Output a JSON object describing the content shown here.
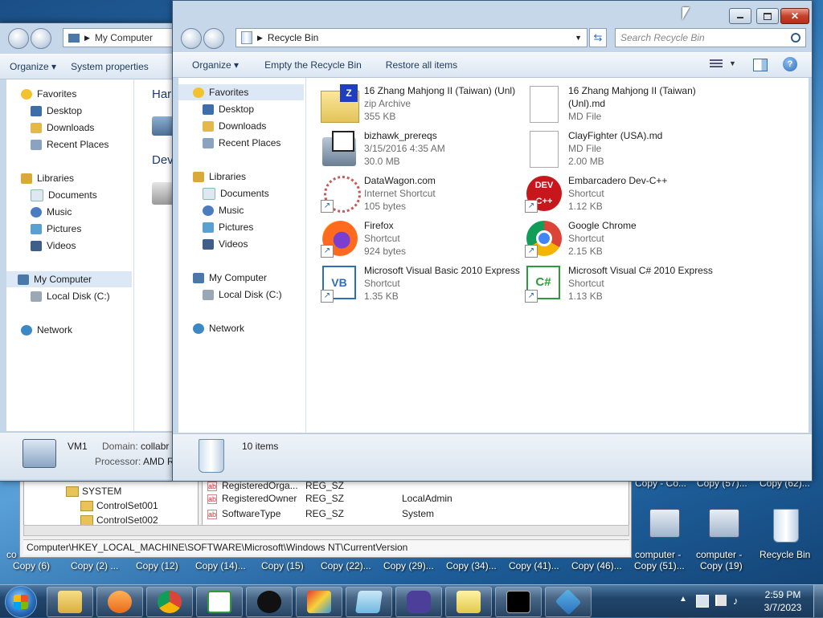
{
  "desktop": {
    "labels": [
      "Copy (6)",
      "Copy (2) ...",
      "Copy (12)",
      "Copy (14)...",
      "Copy (15)",
      "Copy (22)...",
      "Copy (29)...",
      "Copy (34)...",
      "Copy (41)...",
      "Copy (46)...",
      "Copy (51)...",
      "Copy (19)"
    ],
    "top_labels": [
      "Copy - Co...",
      "Copy (57)...",
      "Copy (62)..."
    ],
    "icon_labels": [
      "computer - ",
      "computer - ",
      "Recycle Bin"
    ],
    "left_fragment": "co"
  },
  "back_window": {
    "address": "My Computer",
    "cmd": {
      "organize": "Organize",
      "system_properties": "System properties"
    },
    "nav": {
      "favorites": "Favorites",
      "desktop": "Desktop",
      "downloads": "Downloads",
      "recent": "Recent Places",
      "libraries": "Libraries",
      "documents": "Documents",
      "music": "Music",
      "pictures": "Pictures",
      "videos": "Videos",
      "computer": "My Computer",
      "local_disk": "Local Disk (C:)",
      "network": "Network"
    },
    "content": {
      "group1": "Har",
      "group2": "Dev"
    },
    "status": {
      "name": "VM1",
      "domain_label": "Domain:",
      "domain_value": "collabr",
      "processor_label": "Processor:",
      "processor_value": "AMD R"
    }
  },
  "front_window": {
    "address": "Recycle Bin",
    "search_placeholder": "Search Recycle Bin",
    "cmd": {
      "organize": "Organize",
      "empty": "Empty the Recycle Bin",
      "restore": "Restore all items"
    },
    "nav": {
      "favorites": "Favorites",
      "desktop": "Desktop",
      "downloads": "Downloads",
      "recent": "Recent Places",
      "libraries": "Libraries",
      "documents": "Documents",
      "music": "Music",
      "pictures": "Pictures",
      "videos": "Videos",
      "computer": "My Computer",
      "local_disk": "Local Disk (C:)",
      "network": "Network"
    },
    "files": [
      {
        "name": "16 Zhang Mahjong II (Taiwan) (Unl)",
        "name2": "",
        "type": "zip Archive",
        "size": "355 KB",
        "icon": "zip-archive-icon"
      },
      {
        "name": "16 Zhang Mahjong II (Taiwan)",
        "name2": "(Unl).md",
        "type": "MD File",
        "size": "",
        "icon": "document-icon"
      },
      {
        "name": "bizhawk_prereqs",
        "name2": "",
        "type": "3/15/2016 4:35 AM",
        "size": "30.0 MB",
        "icon": "installer-icon"
      },
      {
        "name": "ClayFighter (USA).md",
        "name2": "",
        "type": "MD File",
        "size": "2.00 MB",
        "icon": "document-icon"
      },
      {
        "name": "DataWagon.com",
        "name2": "",
        "type": "Internet Shortcut",
        "size": "105 bytes",
        "icon": "web-shortcut-icon"
      },
      {
        "name": "Embarcadero Dev-C++",
        "name2": "",
        "type": "Shortcut",
        "size": "1.12 KB",
        "icon": "devcpp-icon"
      },
      {
        "name": "Firefox",
        "name2": "",
        "type": "Shortcut",
        "size": "924 bytes",
        "icon": "firefox-icon"
      },
      {
        "name": "Google Chrome",
        "name2": "",
        "type": "Shortcut",
        "size": "2.15 KB",
        "icon": "chrome-icon"
      },
      {
        "name": "Microsoft Visual Basic 2010 Express",
        "name2": "",
        "type": "Shortcut",
        "size": "1.35 KB",
        "icon": "vb-icon"
      },
      {
        "name": "Microsoft Visual C# 2010 Express",
        "name2": "",
        "type": "Shortcut",
        "size": "1.13 KB",
        "icon": "csharp-icon"
      }
    ],
    "status": {
      "count": "10 items"
    }
  },
  "registry": {
    "tree": {
      "system": "SYSTEM",
      "cs1": "ControlSet001",
      "cs2": "ControlSet002"
    },
    "rows": [
      {
        "name": "RegisteredOrga...",
        "type": "REG_SZ",
        "data": ""
      },
      {
        "name": "RegisteredOwner",
        "type": "REG_SZ",
        "data": "LocalAdmin"
      },
      {
        "name": "SoftwareType",
        "type": "REG_SZ",
        "data": "System"
      }
    ],
    "statusbar": "Computer\\HKEY_LOCAL_MACHINE\\SOFTWARE\\Microsoft\\Windows NT\\CurrentVersion"
  },
  "taskbar": {
    "clock_time": "2:59 PM",
    "clock_date": "3/7/2023",
    "apps": [
      "explorer-icon",
      "media-player-icon",
      "chrome-icon",
      "csharp-icon",
      "penguin-game-icon",
      "mario-emulator-icon",
      "notepad-icon",
      "gameboy-icon",
      "folder-notes-icon",
      "cmd-icon",
      "registry-icon"
    ]
  },
  "colors": {
    "accent": "#3b6ea5",
    "selection": "#dce8f5",
    "taskbar": "#21456b"
  }
}
